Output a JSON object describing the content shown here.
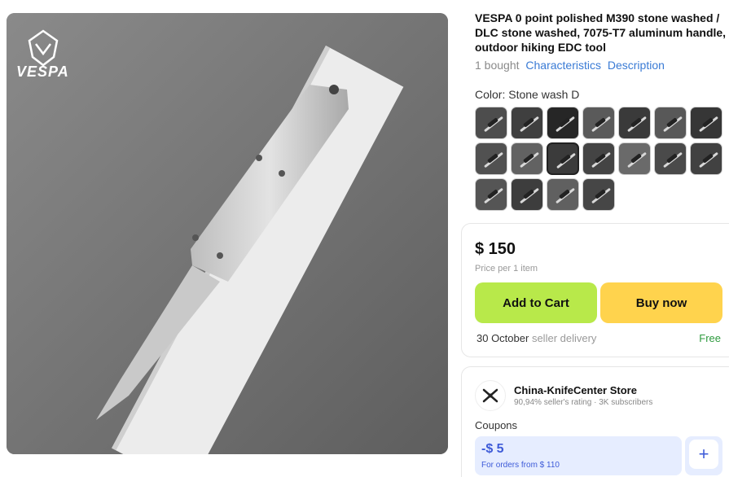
{
  "product": {
    "title": "VESPA 0 point polished M390 stone washed / DLC stone washed, 7075-T7 aluminum handle, outdoor hiking EDC tool",
    "bought": "1 bought",
    "characteristics_link": "Characteristics",
    "description_link": "Description",
    "color_label": "Color: Stone wash D",
    "brand_logo_text": "VESPA",
    "swatch_count": 18,
    "selected_swatch_index": 9
  },
  "purchase": {
    "price": "$ 150",
    "price_note": "Price per 1 item",
    "add_to_cart": "Add to Cart",
    "buy_now": "Buy now",
    "delivery_date": "30 October",
    "delivery_text": "seller delivery",
    "delivery_cost": "Free"
  },
  "store": {
    "name": "China-KnifeCenter Store",
    "rating": "90,94% seller's rating",
    "separator": "·",
    "subscribers": "3K subscribers",
    "coupons_label": "Coupons",
    "coupon_amount": "-$ 5",
    "coupon_condition": "For orders from $ 110",
    "add_coupon": "+"
  },
  "colors": {
    "cart_button": "#b8e94a",
    "buy_button": "#ffd34d",
    "link": "#3a7bd5",
    "free": "#2e9a3e",
    "coupon_bg": "#e6edff",
    "coupon_text": "#3e5bd8"
  }
}
